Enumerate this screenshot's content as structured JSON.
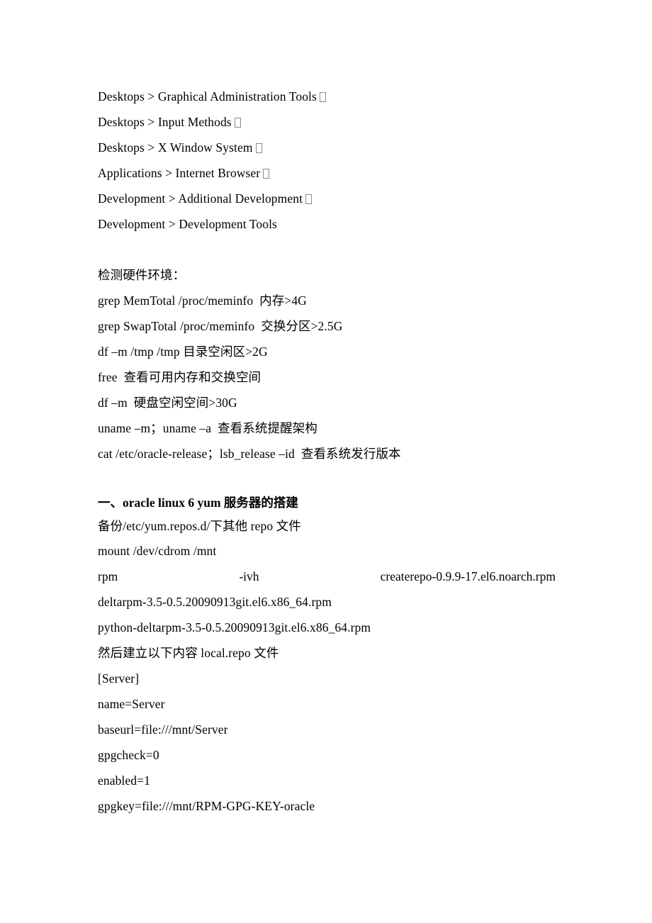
{
  "document": {
    "background_color": "#ffffff",
    "text_color": "#000000",
    "package_groups": {
      "lines": [
        {
          "text": "Desktops > Graphical Administration Tools",
          "trailing_box": true
        },
        {
          "text": "Desktops > Input Methods",
          "trailing_box": true
        },
        {
          "text": "Desktops > X Window System",
          "trailing_box": true
        },
        {
          "text": "Applications > Internet Browser",
          "trailing_box": true
        },
        {
          "text": "Development > Additional Development",
          "trailing_box": true
        },
        {
          "text": "Development > Development Tools",
          "trailing_box": false
        }
      ]
    },
    "hardware_check": {
      "title": "检测硬件环境：",
      "lines": [
        "grep MemTotal /proc/meminfo  内存>4G",
        "grep SwapTotal /proc/meminfo  交换分区>2.5G",
        "df –m /tmp /tmp 目录空闲区>2G",
        "free  查看可用内存和交换空间",
        "df –m  硬盘空闲空间>30G",
        "uname –m；uname –a  查看系统提醒架构",
        "cat /etc/oracle-release；lsb_release –id  查看系统发行版本"
      ]
    },
    "yum_section": {
      "heading": "一、oracle linux 6 yum 服务器的搭建",
      "backup_line": "备份/etc/yum.repos.d/下其他 repo 文件",
      "mount_line": "mount /dev/cdrom /mnt",
      "rpm_command": {
        "part1": "rpm",
        "part2": "-ivh",
        "part3": "createrepo-0.9.9-17.el6.noarch.rpm"
      },
      "rpm_packages": [
        "deltarpm-3.5-0.5.20090913git.el6.x86_64.rpm",
        "python-deltarpm-3.5-0.5.20090913git.el6.x86_64.rpm"
      ],
      "repo_intro": "然后建立以下内容 local.repo 文件",
      "repo_config": [
        "[Server]",
        "name=Server",
        "baseurl=file:///mnt/Server",
        "gpgcheck=0",
        "enabled=1",
        "gpgkey=file:///mnt/RPM-GPG-KEY-oracle"
      ]
    }
  }
}
